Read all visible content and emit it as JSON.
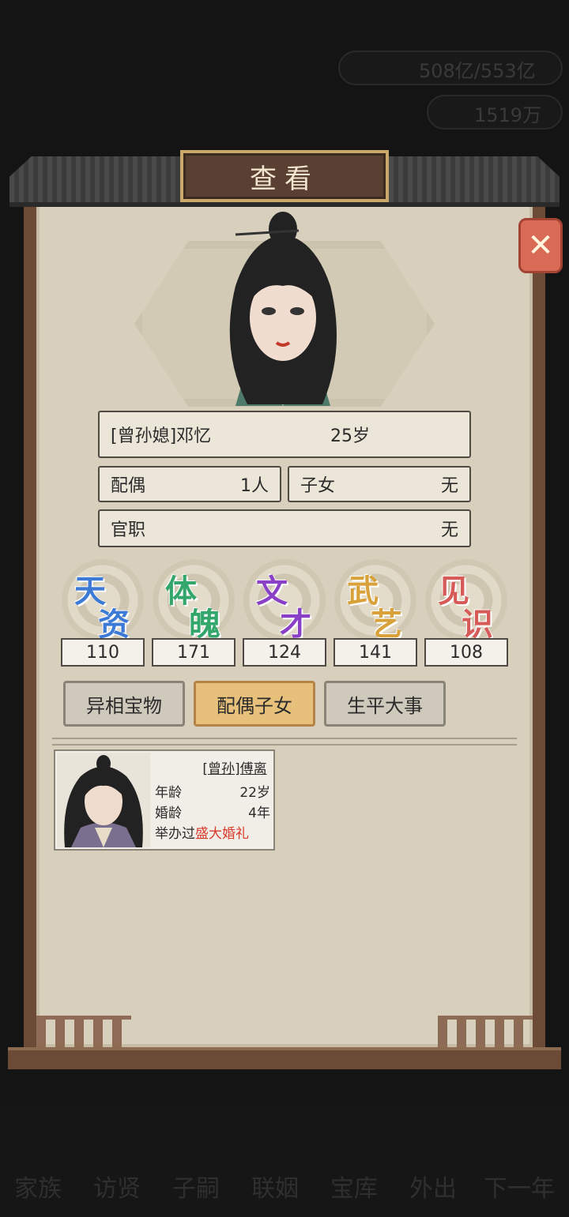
{
  "background": {
    "currency_1": "508亿/553亿",
    "currency_2": "1519万",
    "bottom_nav": [
      "家族",
      "访贤",
      "子嗣",
      "联姻",
      "宝库",
      "外出",
      "下一年"
    ]
  },
  "dialog": {
    "title": "查看",
    "close_icon": "close-x-icon"
  },
  "character": {
    "name": "[曾孙媳]邓忆",
    "age": "25岁",
    "spouse_label": "配偶",
    "spouse_value": "1人",
    "children_label": "子女",
    "children_value": "无",
    "office_label": "官职",
    "office_value": "无"
  },
  "stats": [
    {
      "label_1": "天",
      "label_2": "资",
      "value": "110",
      "color": "#3d7ad6"
    },
    {
      "label_1": "体",
      "label_2": "魄",
      "value": "171",
      "color": "#33a66b"
    },
    {
      "label_1": "文",
      "label_2": "才",
      "value": "124",
      "color": "#8a3fc7"
    },
    {
      "label_1": "武",
      "label_2": "艺",
      "value": "141",
      "color": "#d8a13a"
    },
    {
      "label_1": "见",
      "label_2": "识",
      "value": "108",
      "color": "#d65a58"
    }
  ],
  "tabs": [
    {
      "label": "异相宝物",
      "active": false
    },
    {
      "label": "配偶子女",
      "active": true
    },
    {
      "label": "生平大事",
      "active": false
    }
  ],
  "spouse_card": {
    "name": "[曾孙]傅离",
    "age_label": "年龄",
    "age_value": "22岁",
    "marriage_label": "婚龄",
    "marriage_value": "4年",
    "wedding_prefix": "举办过",
    "wedding_highlight": "盛大婚礼"
  }
}
